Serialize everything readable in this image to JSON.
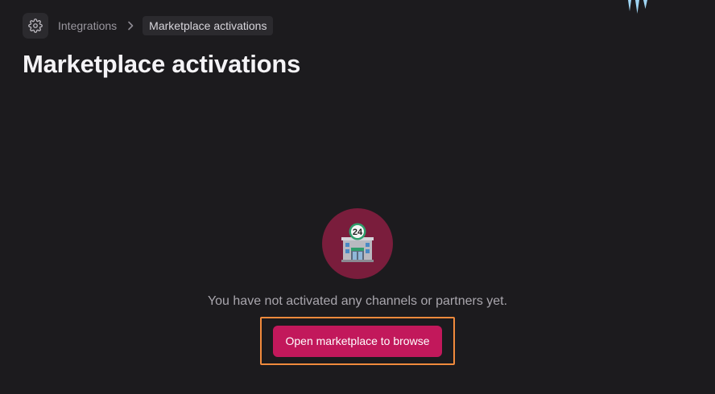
{
  "breadcrumb": {
    "settings_icon": "gear-icon",
    "parent_label": "Integrations",
    "separator_icon": "chevron-right-icon",
    "current_label": "Marketplace activations"
  },
  "page": {
    "title": "Marketplace activations"
  },
  "empty_state": {
    "icon": "convenience-store-24-icon",
    "icon_badge": "24",
    "message": "You have not activated any channels or partners yet.",
    "cta_label": "Open marketplace to browse"
  },
  "colors": {
    "background": "#1c1b1e",
    "accent": "#c2185b",
    "icon_circle": "#7a1d3c",
    "focus_outline": "#f08a3c"
  }
}
